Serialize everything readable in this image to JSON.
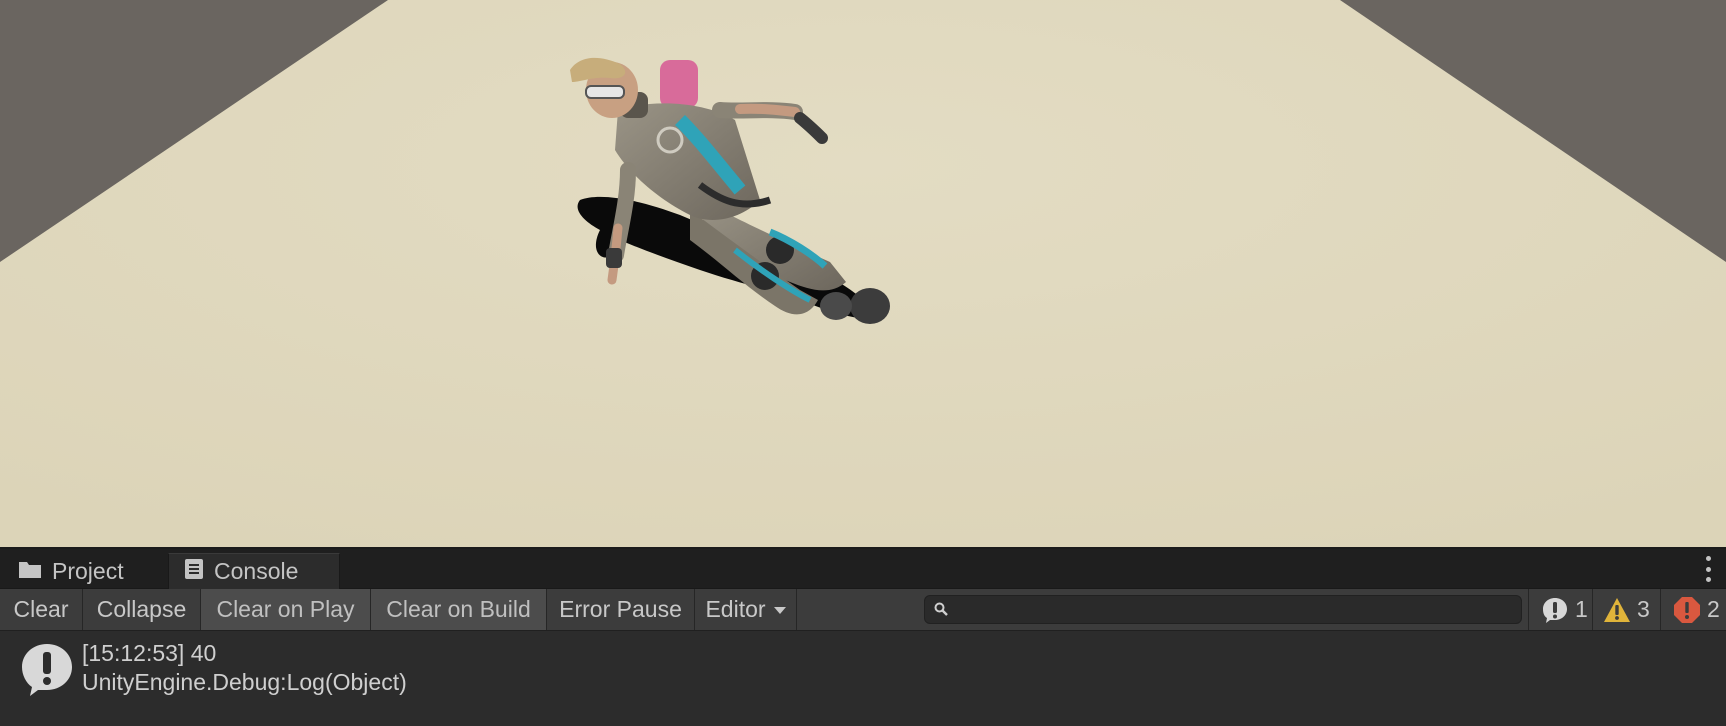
{
  "scene": {
    "background_color": "#6a6560",
    "ground_color": "#e0d9c0"
  },
  "tabs": [
    {
      "label": "Project",
      "icon": "folder-icon"
    },
    {
      "label": "Console",
      "icon": "console-icon"
    }
  ],
  "toolbar": {
    "clear": "Clear",
    "collapse": "Collapse",
    "clear_on_play": "Clear on Play",
    "clear_on_build": "Clear on Build",
    "error_pause": "Error Pause",
    "editor": "Editor",
    "search_placeholder": ""
  },
  "counters": {
    "info": "1",
    "warning": "3",
    "error": "2"
  },
  "log": [
    {
      "line1": "[15:12:53] 40",
      "line2": "UnityEngine.Debug:Log(Object)",
      "type": "info"
    }
  ],
  "colors": {
    "warning": "#e0b43a",
    "error": "#d9583f"
  }
}
